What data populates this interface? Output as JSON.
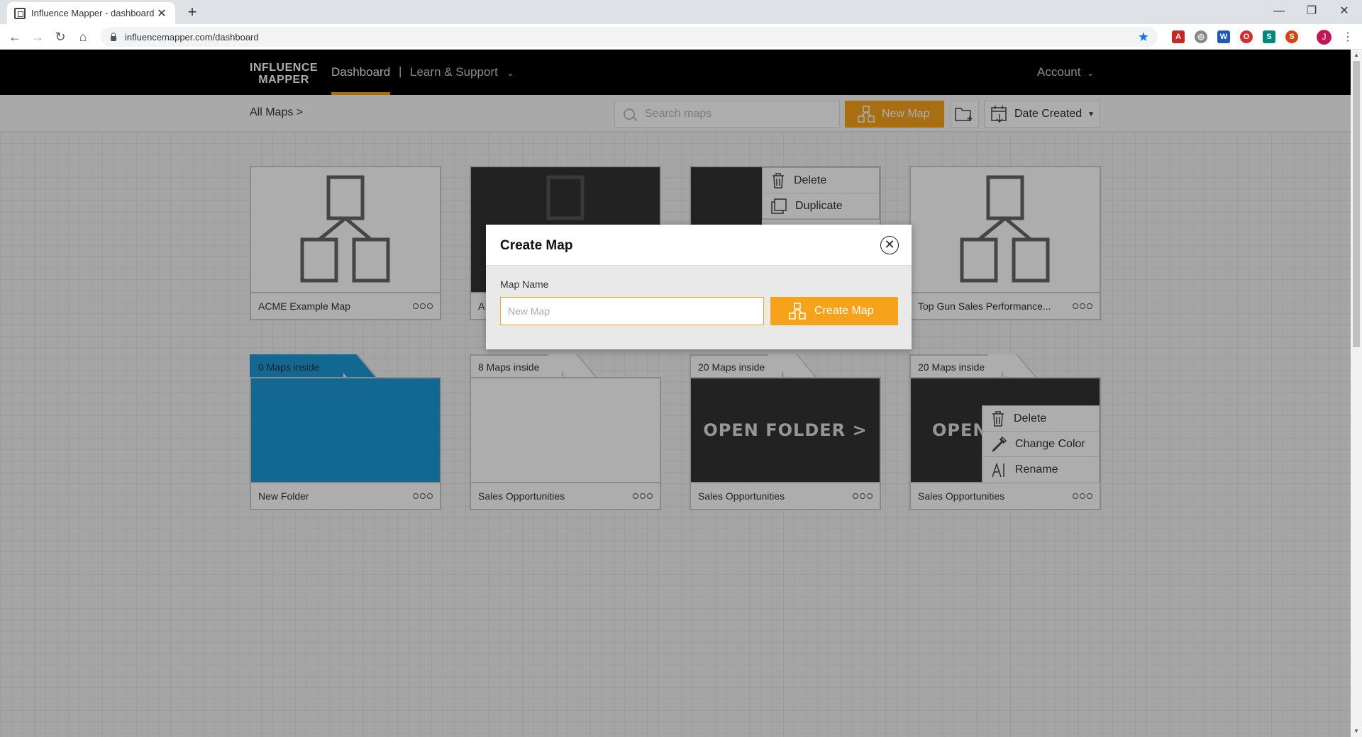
{
  "browser": {
    "tab_title": "Influence Mapper - dashboard",
    "url": "influencemapper.com/dashboard",
    "profile_initial": "J"
  },
  "header": {
    "logo_line1": "INFLUENCE",
    "logo_line2": "MAPPER",
    "nav_dashboard": "Dashboard",
    "nav_separator": "|",
    "nav_learn": "Learn & Support",
    "account": "Account"
  },
  "toolbar": {
    "breadcrumb": "All Maps  >",
    "search_placeholder": "Search maps",
    "new_map_label": "New Map",
    "sort_label": "Date Created"
  },
  "maps": [
    {
      "name": "ACME Example Map"
    },
    {
      "name": "A"
    },
    {
      "name": ""
    },
    {
      "name": "Top Gun Sales Performance..."
    }
  ],
  "map_menu": {
    "delete": "Delete",
    "duplicate": "Duplicate"
  },
  "folders": [
    {
      "count": "0 Maps inside",
      "name": "New Folder",
      "color": "#1b9ad6"
    },
    {
      "count": "8 Maps inside",
      "name": "Sales Opportunities"
    },
    {
      "count": "20 Maps inside",
      "name": "Sales Opportunities",
      "overlay": "OPEN FOLDER  >"
    },
    {
      "count": "20 Maps inside",
      "name": "Sales Opportunities",
      "overlay": "OPEN"
    }
  ],
  "folder_menu": {
    "delete": "Delete",
    "change_color": "Change Color",
    "rename": "Rename"
  },
  "modal": {
    "title": "Create Map",
    "field_label": "Map Name",
    "input_placeholder": "New Map",
    "create_label": "Create Map"
  },
  "colors": {
    "accent": "#f7a21b",
    "folder_blue": "#1b9ad6",
    "header_bg": "#000000"
  }
}
